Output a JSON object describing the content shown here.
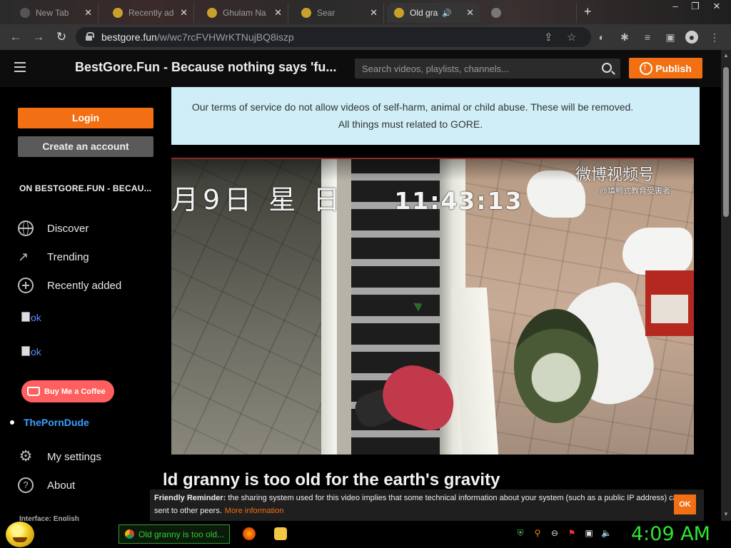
{
  "browser": {
    "tabs": [
      {
        "label": "New Tab",
        "active": false
      },
      {
        "label": "Recently ad",
        "active": false
      },
      {
        "label": "Ghulam Na",
        "active": false
      },
      {
        "label": "Sear",
        "active": false
      },
      {
        "label": "Old gra",
        "active": true
      }
    ],
    "url_domain": "bestgore.fun",
    "url_path": "/w/wc7rcFVHWrKTNujBQ8iszp"
  },
  "header": {
    "site_title": "BestGore.Fun - Because nothing says 'fu...",
    "search_placeholder": "Search videos, playlists, channels...",
    "publish_label": "Publish"
  },
  "sidebar": {
    "login_label": "Login",
    "create_account_label": "Create an account",
    "section_heading": "ON BESTGORE.FUN - BECAU...",
    "nav": [
      {
        "label": "Discover",
        "icon": "globe-icon"
      },
      {
        "label": "Trending",
        "icon": "trending-icon"
      },
      {
        "label": "Recently added",
        "icon": "plus-circle-icon"
      }
    ],
    "broken_images": [
      "ok",
      "ok"
    ],
    "buy_coffee_label": "Buy Me a Coffee",
    "external_link": "ThePornDude",
    "bottom_nav": [
      {
        "label": "My settings",
        "icon": "gear-icon"
      },
      {
        "label": "About",
        "icon": "help-icon"
      }
    ],
    "interface_label": "Interface: English"
  },
  "notice": {
    "line1": "Our terms of service do not allow videos of self-harm, animal or child abuse. These will be removed.",
    "line2": "All things must related to GORE."
  },
  "video": {
    "overlay_date": "月9日 星 日",
    "overlay_time": "11:43:13",
    "watermark_brand": "微博视频号",
    "watermark_handle": "@填鸭式教育受害者"
  },
  "video_title": "ld granny is too old for the earth's gravity",
  "cookie_banner": {
    "bold": "Friendly Reminder:",
    "text": "the sharing system used for this video implies that some technical information about your system (such as a public IP address) can be sent to other peers.",
    "link": "More information",
    "ok_label": "OK"
  },
  "taskbar": {
    "task_label": "Old granny is too old...",
    "clock": "4:09 AM"
  }
}
